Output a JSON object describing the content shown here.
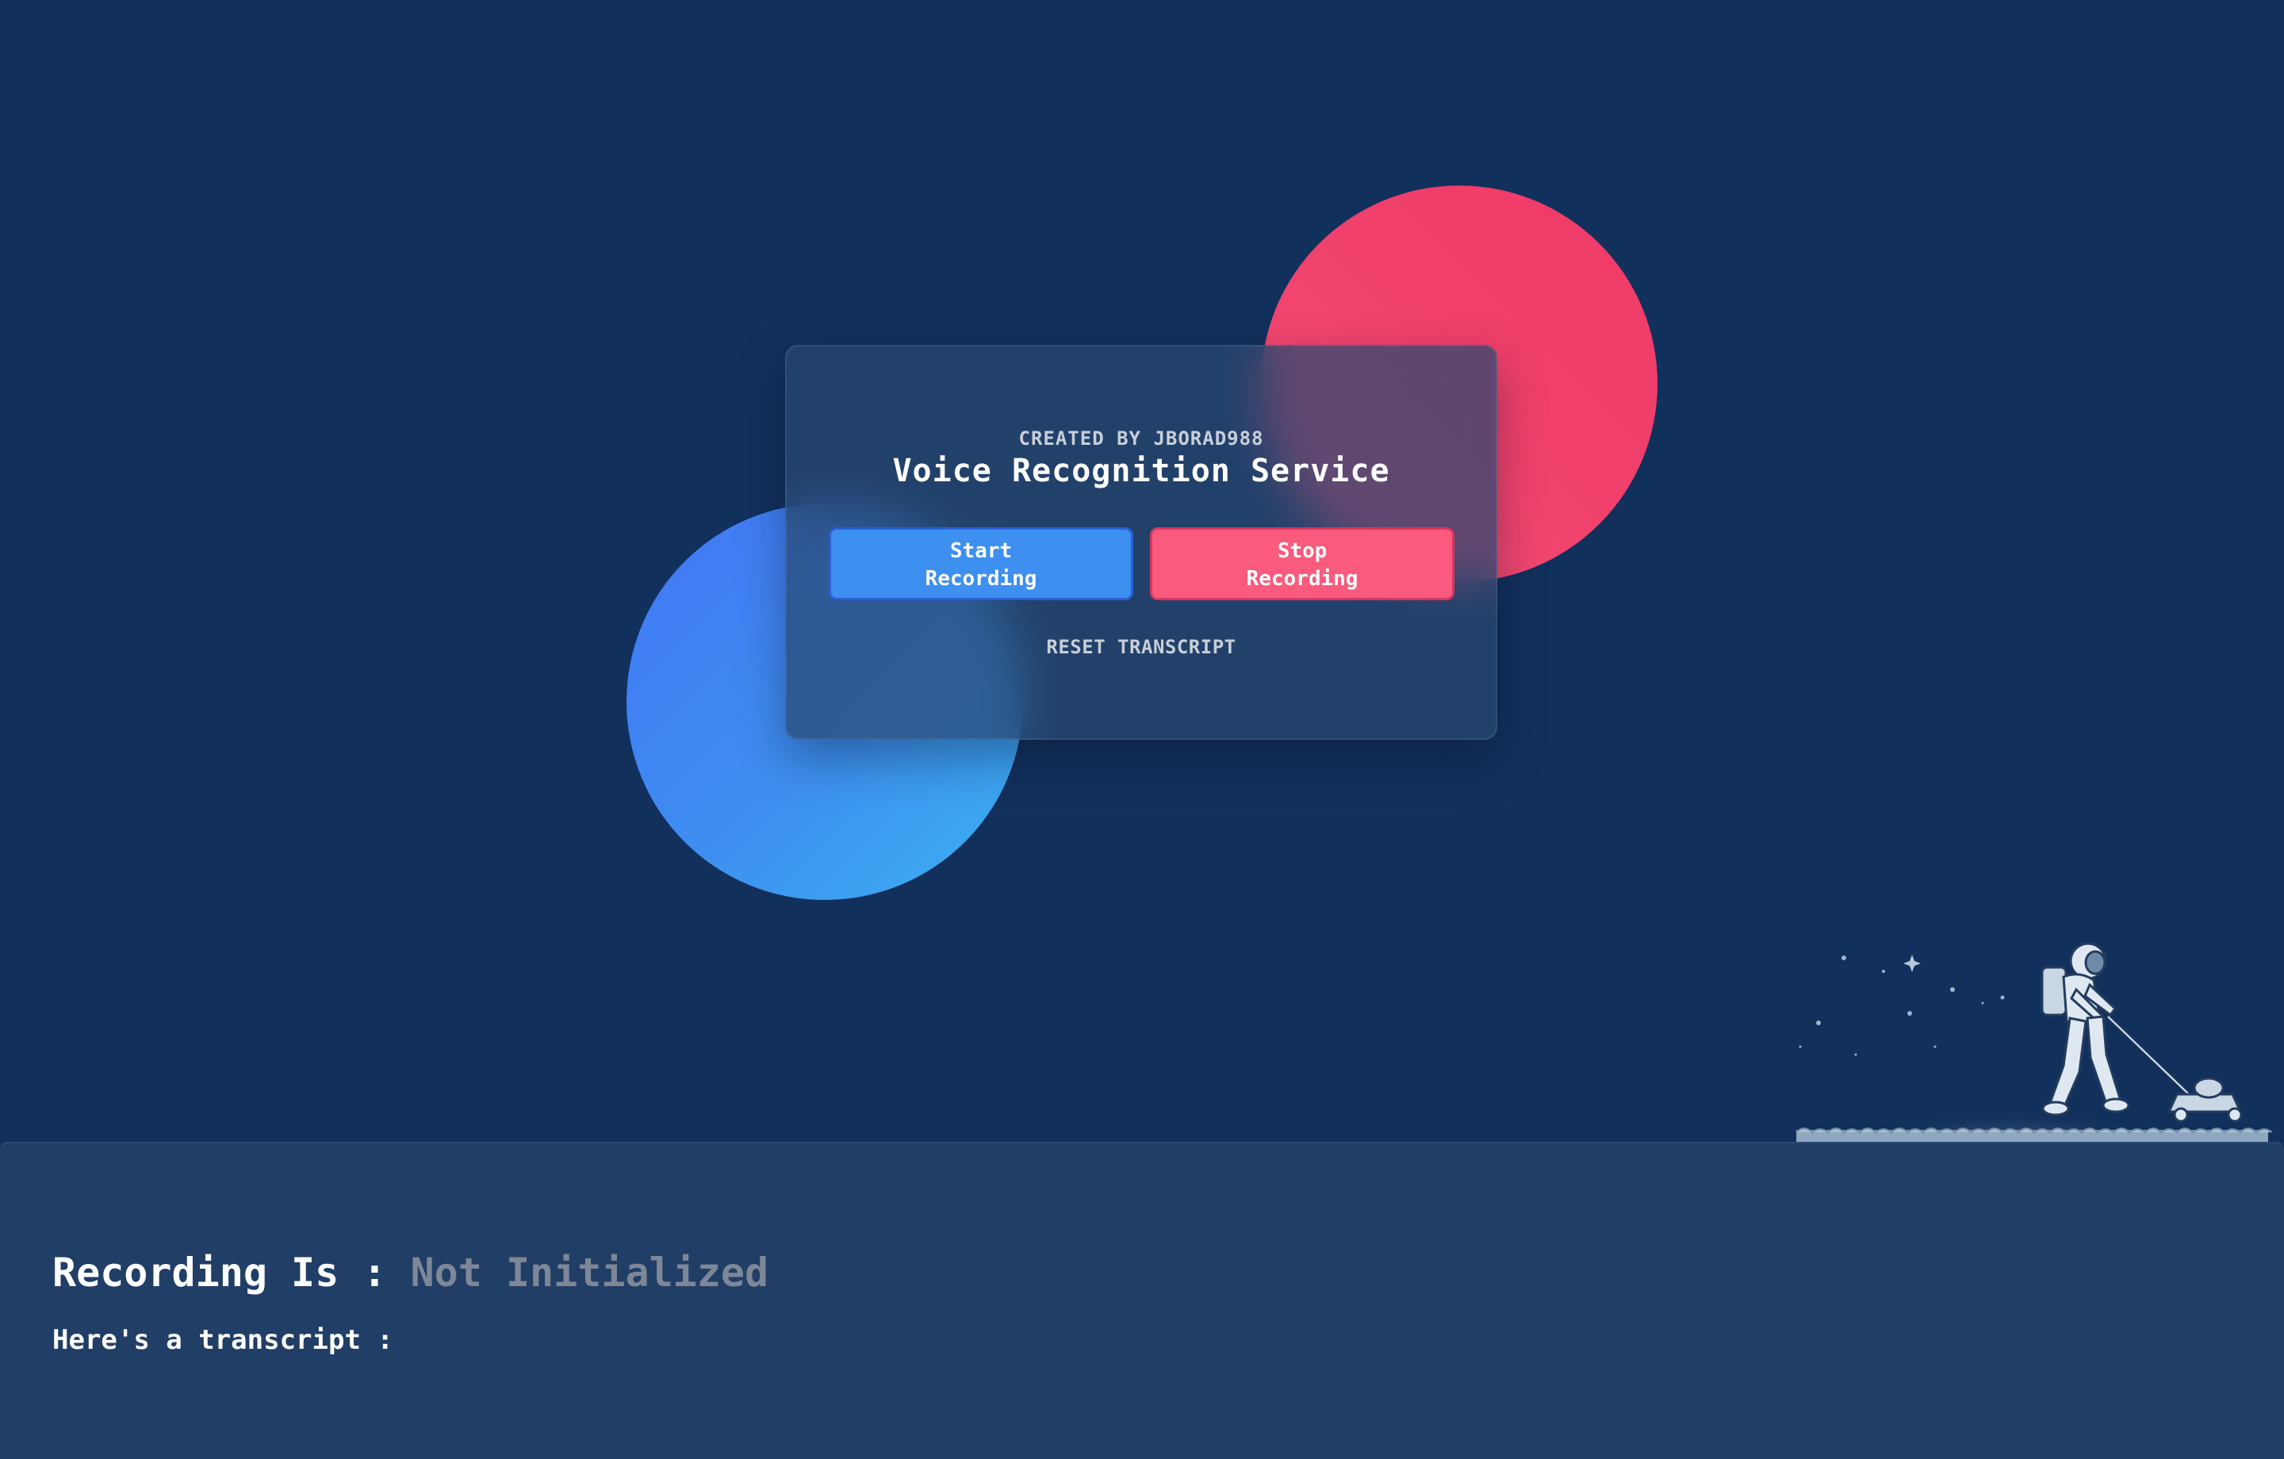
{
  "card": {
    "credit": "CREATED BY JBORAD988",
    "title": "Voice Recognition Service",
    "start_button": "Start\nRecording",
    "stop_button": "Stop\nRecording",
    "reset_link": "RESET TRANSCRIPT"
  },
  "status": {
    "label": "Recording Is : ",
    "value": "Not Initialized"
  },
  "transcript": {
    "label": "Here's a transcript :",
    "text": ""
  },
  "colors": {
    "background": "#12305c",
    "panel": "#213e66",
    "start_button": "#3d8ff0",
    "stop_button": "#fa5a7d",
    "status_value": "#7d8797"
  },
  "illustration": {
    "icon": "astronaut-mowing-moon-icon"
  }
}
